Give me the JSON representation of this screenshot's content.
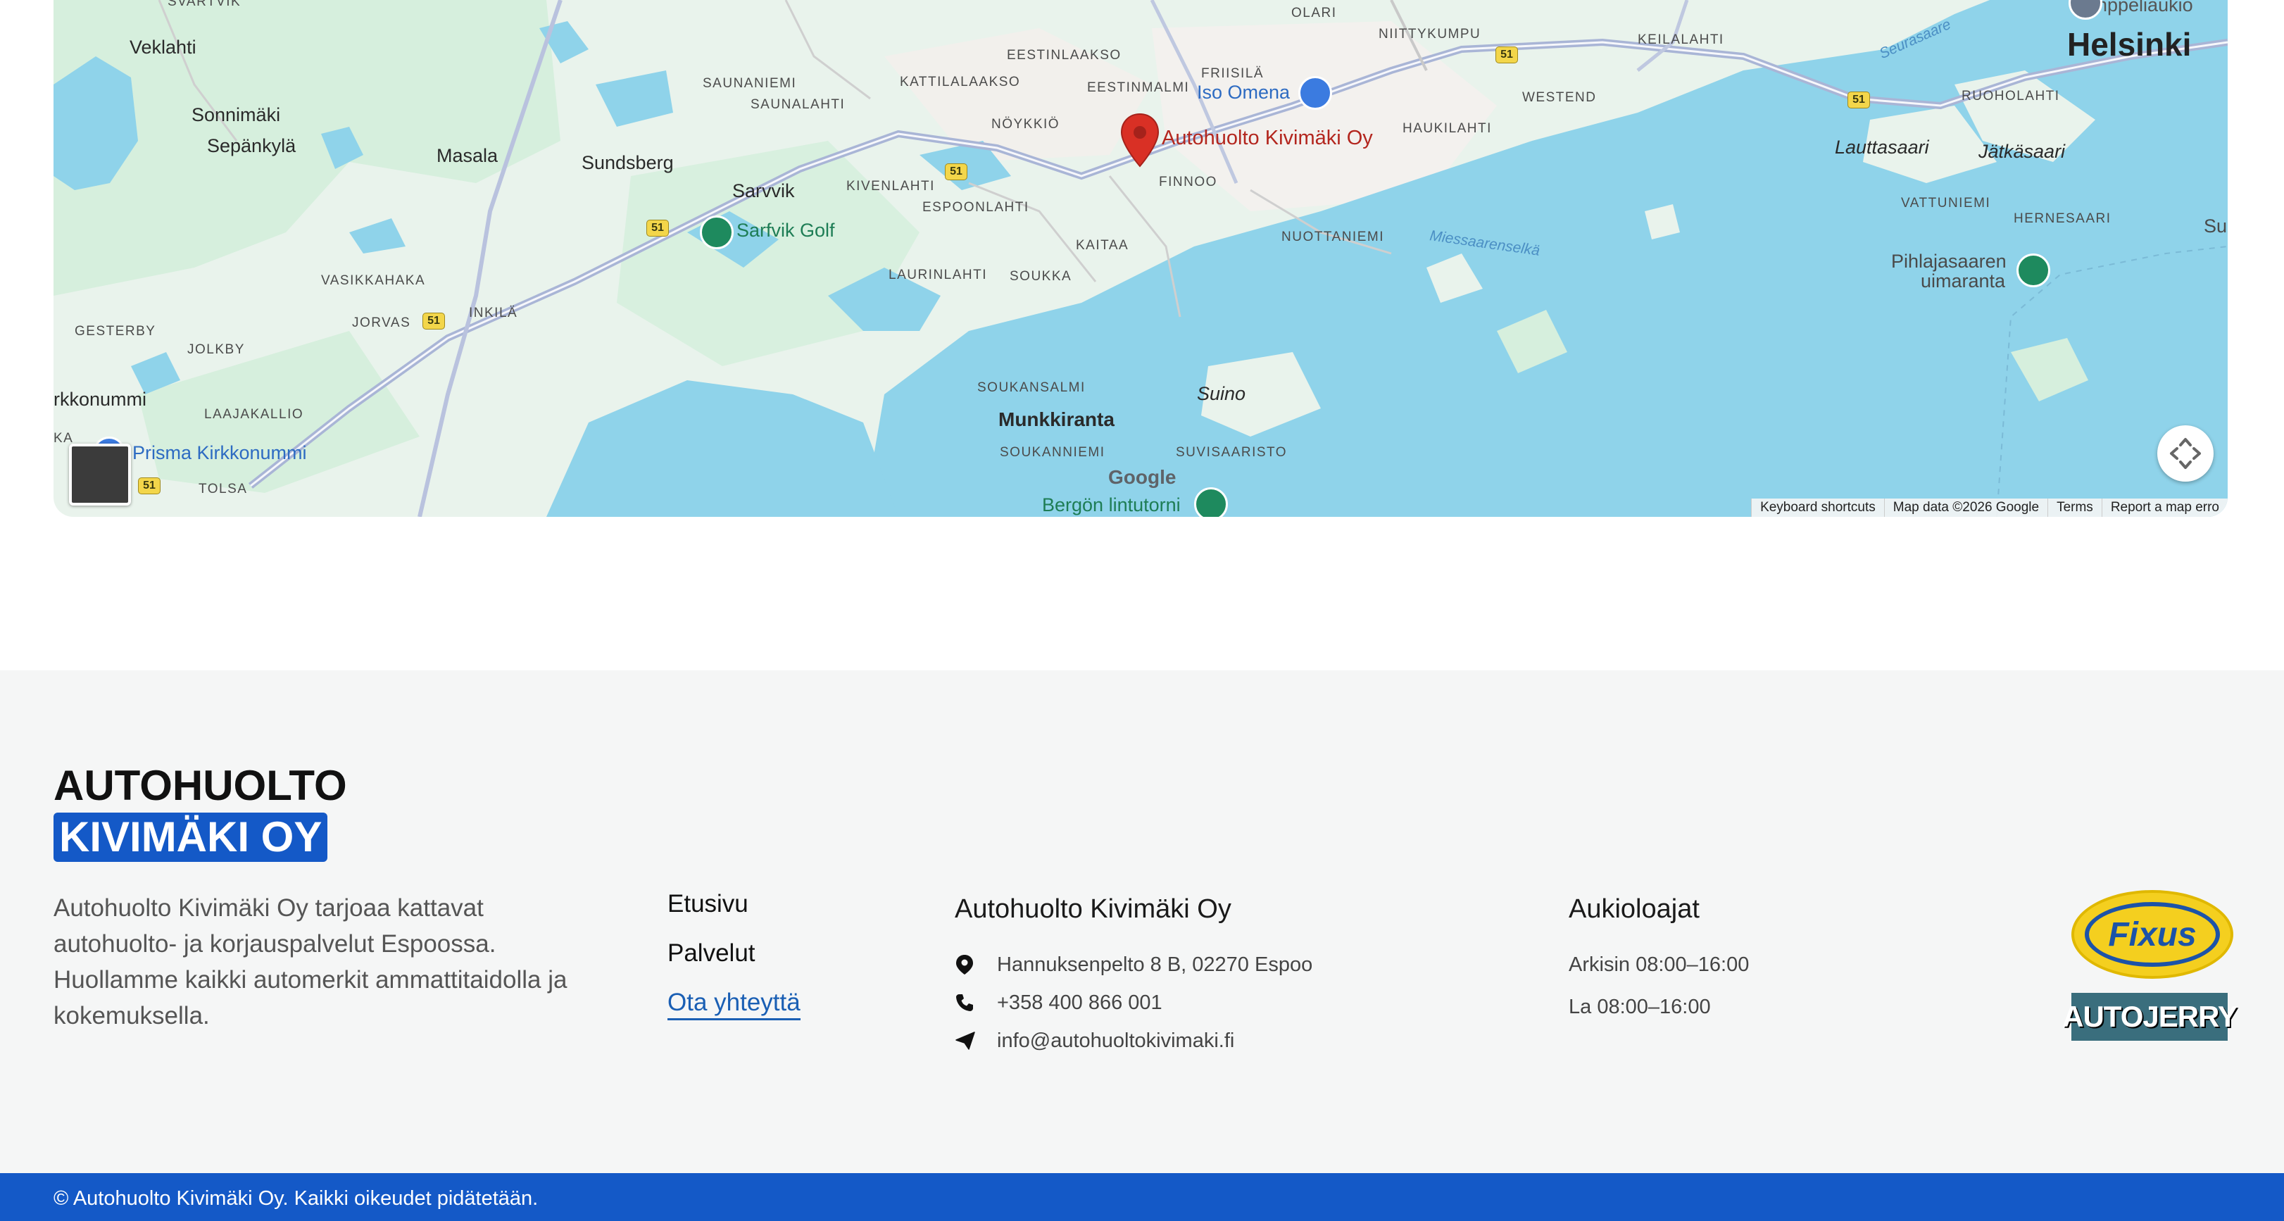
{
  "map": {
    "labels": {
      "svartvik": "SVARTVIK",
      "veklahti": "Veklahti",
      "sonnimaki": "Sonnimäki",
      "sepankyla": "Sepänkylä",
      "masala": "Masala",
      "sundsberg": "Sundsberg",
      "sarvvik": "Sarvvik",
      "vasikkahaka": "VASIKKAHAKA",
      "jorvas": "JORVAS",
      "inkila": "INKILÄ",
      "gesterby": "GESTERBY",
      "jolkby": "JOLKBY",
      "kirkkonummi": "rkkonummi",
      "laajakallio": "LAAJAKALLIO",
      "tolsa": "TOLSA",
      "ka": "KA",
      "saunaniemi": "SAUNANIEMI",
      "saunalahti": "SAUNALAHTI",
      "kattilalaakso": "KATTILALAAKSO",
      "eestinlaakso": "EESTINLAAKSO",
      "eestinmalmi": "EESTINMALMI",
      "noykkio": "NÖYKKIÖ",
      "kivenlahti": "KIVENLAHTI",
      "espoonlahti": "ESPOONLAHTI",
      "finnoo": "FINNOO",
      "laurinlahti": "LAURINLAHTI",
      "soukka": "SOUKKA",
      "kaitaa": "KAITAA",
      "soukansalmi": "SOUKANSALMI",
      "munkkiranta": "Munkkiranta",
      "soukanniemi": "SOUKANNIEMI",
      "suino": "Suino",
      "suvisaaristo": "SUVISAARISTO",
      "olari": "OLARI",
      "niittykumpu": "NIITTYKUMPU",
      "frisila": "FRIISILÄ",
      "westend": "WESTEND",
      "haukilahti": "HAUKILAHTI",
      "nuottaniemi": "NUOTTANIEMI",
      "miessaarenselka": "Miessaarenselkä",
      "keilalahti": "KEILALAHTI",
      "ruoholahti": "RUOHOLAHTI",
      "lauttasaari": "Lauttasaari",
      "jatkasaari": "Jätkäsaari",
      "vattuniemi": "VATTUNIEMI",
      "hernesaari": "HERNESAARI",
      "helsinki": "Helsinki",
      "seurasaari": "Seurasaare",
      "su": "Su",
      "temppeliaukio": "Temppeliaukio",
      "pihlajasaaren": "Pihlajasaaren",
      "uimaranta": "uimaranta"
    },
    "pois": {
      "sarfvik_golf": "Sarfvik Golf",
      "iso_omena": "Iso Omena",
      "prisma": "Prisma Kirkkonummi",
      "bergon": "Bergön lintutorni"
    },
    "marker_label": "Autohuolto Kivimäki Oy",
    "road_number": "51",
    "google_logo": "Google",
    "attribution": {
      "shortcuts": "Keyboard shortcuts",
      "data": "Map data ©2026 Google",
      "terms": "Terms",
      "report": "Report a map erro"
    }
  },
  "footer": {
    "logo": {
      "line1": "AUTOHUOLTO",
      "line2": "KIVIMÄKI OY"
    },
    "description": "Autohuolto Kivimäki Oy tarjoaa kattavat autohuolto- ja korjauspalvelut Espoossa. Huollamme kaikki automerkit ammattitaidolla ja kokemuksella.",
    "nav": {
      "home": "Etusivu",
      "services": "Palvelut",
      "contact": "Ota yhteyttä"
    },
    "contact": {
      "heading": "Autohuolto Kivimäki Oy",
      "address": "Hannuksenpelto 8 B, 02270 Espoo",
      "phone": "+358 400 866 001",
      "email": "info@autohuoltokivimaki.fi"
    },
    "hours": {
      "heading": "Aukioloajat",
      "weekdays": "Arkisin 08:00–16:00",
      "saturday": "La 08:00–16:00"
    },
    "partners": {
      "fixus": "Fixus",
      "autojerry": "AUTOJERRY"
    },
    "copyright": "© Autohuolto Kivimäki Oy. Kaikki oikeudet pidätetään."
  },
  "colors": {
    "brand_blue": "#1459c7",
    "link_blue": "#1a5fb4",
    "marker_red": "#d93025",
    "water": "#8fd3ea",
    "land": "#e9f3ec"
  }
}
